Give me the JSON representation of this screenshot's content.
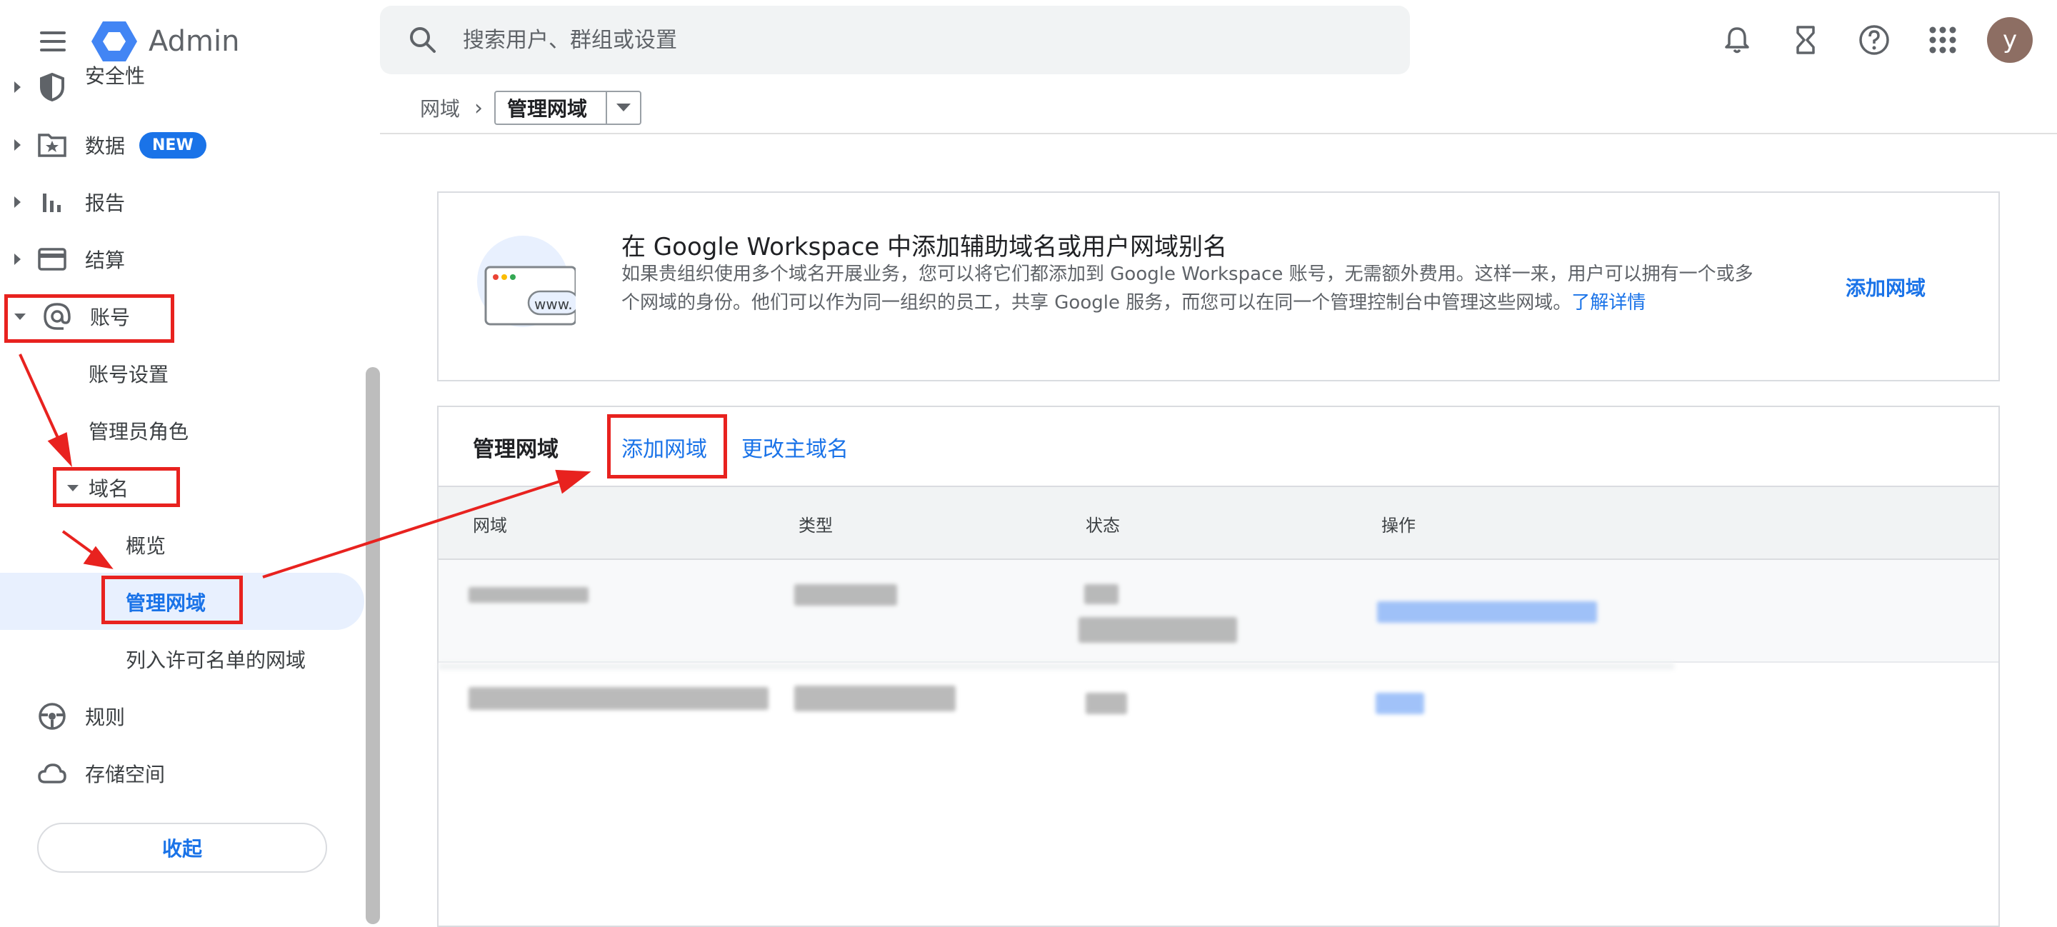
{
  "app": {
    "title": "Admin"
  },
  "search": {
    "placeholder": "搜索用户、群组或设置"
  },
  "header_icons": [
    "bell-icon",
    "hourglass-icon",
    "help-icon",
    "apps-grid-icon"
  ],
  "user": {
    "initial": "y",
    "avatar_color": "#8d6e63"
  },
  "sidebar": {
    "items": [
      {
        "label": "安全性",
        "icon": "shield-icon"
      },
      {
        "label": "数据",
        "icon": "data-star-folder-icon",
        "badge": "NEW"
      },
      {
        "label": "报告",
        "icon": "bar-chart-icon"
      },
      {
        "label": "结算",
        "icon": "credit-card-icon"
      },
      {
        "label": "账号",
        "icon": "at-sign-icon",
        "expanded": true
      },
      {
        "label": "规则",
        "icon": "steering-wheel-icon"
      },
      {
        "label": "存储空间",
        "icon": "cloud-icon"
      }
    ],
    "account_sub": {
      "settings": "账号设置",
      "admin_roles": "管理员角色",
      "domains": "域名",
      "overview": "概览",
      "manage_domains": "管理网域",
      "allowlisted": "列入许可名单的网域"
    },
    "collapse": "收起"
  },
  "breadcrumb": {
    "root": "网域",
    "separator": "›",
    "current": "管理网域"
  },
  "promo": {
    "title": "在 Google Workspace 中添加辅助域名或用户网域别名",
    "description": "如果贵组织使用多个域名开展业务，您可以将它们都添加到 Google Workspace 账号，无需额外费用。这样一来，用户可以拥有一个或多个网域的身份。他们可以作为同一组织的员工，共享 Google 服务，而您可以在同一个管理控制台中管理这些网域。",
    "learn_more": "了解详情",
    "add_domain": "添加网域",
    "illustration_text": "www."
  },
  "domains_panel": {
    "title": "管理网域",
    "add_domain": "添加网域",
    "change_primary": "更改主域名",
    "columns": [
      "网域",
      "类型",
      "状态",
      "操作"
    ]
  },
  "colors": {
    "accent": "#1a73e8",
    "highlight": "#e8221f",
    "selected_bg": "#e8f0fe"
  }
}
